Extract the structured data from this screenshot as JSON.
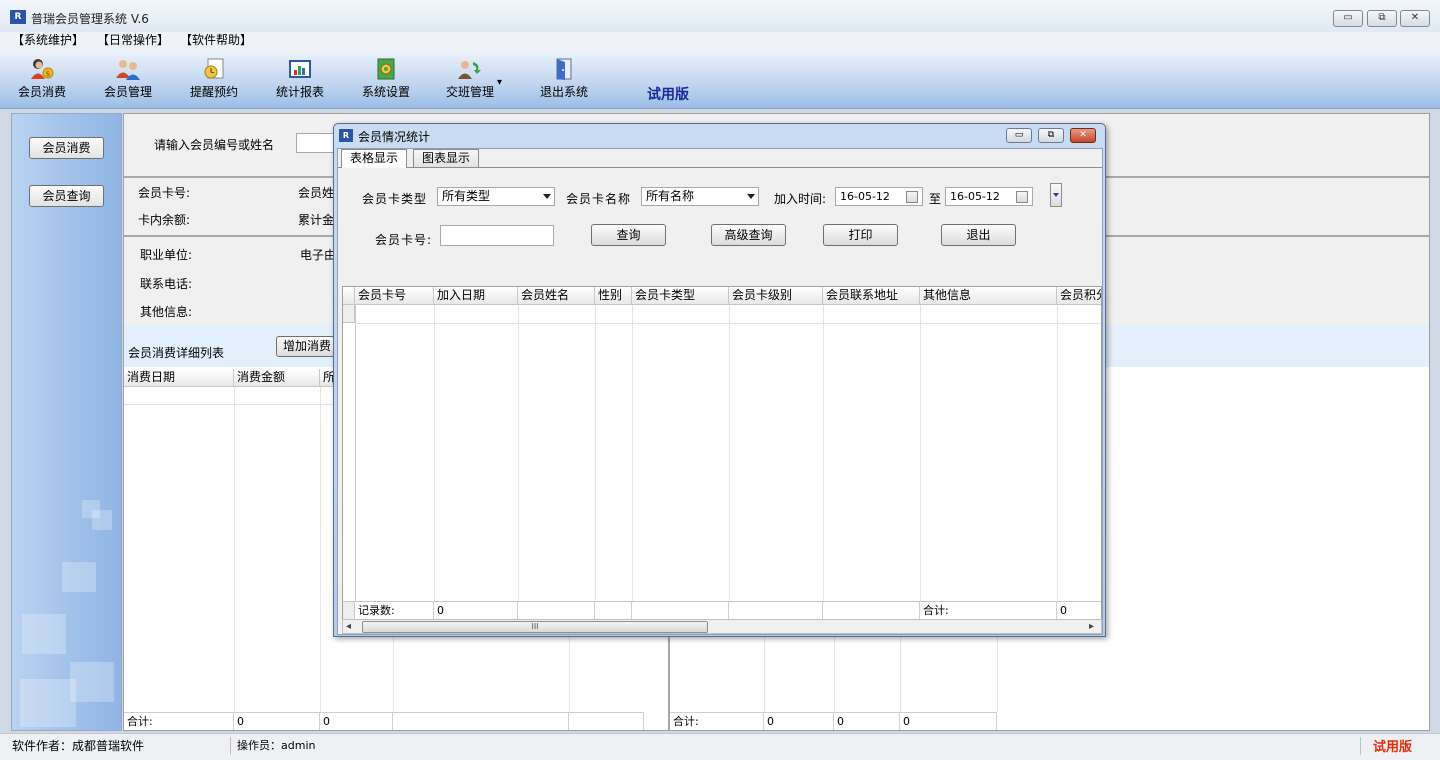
{
  "window": {
    "title": "普瑞会员管理系统 V.6",
    "logo": "R",
    "minimize_glyph": "▭",
    "restore_glyph": "⧉",
    "close_glyph": "✕"
  },
  "menu": [
    "【系统维护】",
    "【日常操作】",
    "【软件帮助】"
  ],
  "toolbar": {
    "items": [
      {
        "label": "会员消费",
        "icon": "member-consume-icon"
      },
      {
        "label": "会员管理",
        "icon": "member-manage-icon"
      },
      {
        "label": "提醒预约",
        "icon": "reminder-icon"
      },
      {
        "label": "统计报表",
        "icon": "report-icon"
      },
      {
        "label": "系统设置",
        "icon": "settings-icon"
      },
      {
        "label": "交班管理",
        "icon": "shift-icon"
      },
      {
        "label": "退出系统",
        "icon": "exit-icon"
      }
    ],
    "dropdown_glyph": "▾",
    "trial": "试用版"
  },
  "left_nav": [
    "会员消费",
    "会员查询"
  ],
  "main": {
    "search_label": "请输入会员编号或姓名",
    "row1": {
      "card_no": "会员卡号:",
      "name": "会员姓",
      "balance": "卡内余额:",
      "total": "累计金"
    },
    "row2": {
      "company": "职业单位:",
      "email": "电子由",
      "phone": "联系电话:",
      "other": "其他信息:"
    },
    "detail_title": "会员消费详细列表",
    "add_btn": "增加消费",
    "left_cols": [
      "消费日期",
      "消费金额",
      "所"
    ],
    "left_sum": {
      "label": "合计:",
      "v1": "0",
      "v2": "0"
    },
    "right_sum": {
      "label": "合计:",
      "v1": "0",
      "v2": "0",
      "v3": "0"
    }
  },
  "statusbar": {
    "author": "软件作者：成都普瑞软件",
    "operator": "操作员：admin",
    "trial": "试用版"
  },
  "dialog": {
    "title": "会员情况统计",
    "logo": "R",
    "tabs": [
      "表格显示",
      "图表显示"
    ],
    "card_type_label": "会员卡类型",
    "card_type_value": "所有类型",
    "card_name_label": "会员卡名称",
    "card_name_value": "所有名称",
    "join_label": "加入时间:",
    "date_from": "16-05-12",
    "to_label": "至",
    "date_to": "16-05-12",
    "card_no_label": "会员卡号:",
    "card_no_value": "",
    "buttons": {
      "query": "查询",
      "advanced": "高级查询",
      "print": "打印",
      "exit": "退出"
    },
    "columns": [
      "会员卡号",
      "加入日期",
      "会员姓名",
      "性别",
      "会员卡类型",
      "会员卡级别",
      "会员联系地址",
      "其他信息",
      "会员积分"
    ],
    "footer": {
      "count_label": "记录数:",
      "count": "0",
      "sum_label": "合计:",
      "sum": "0"
    },
    "scroll_grip": "III",
    "scroll_left": "◂",
    "scroll_right": "▸"
  }
}
